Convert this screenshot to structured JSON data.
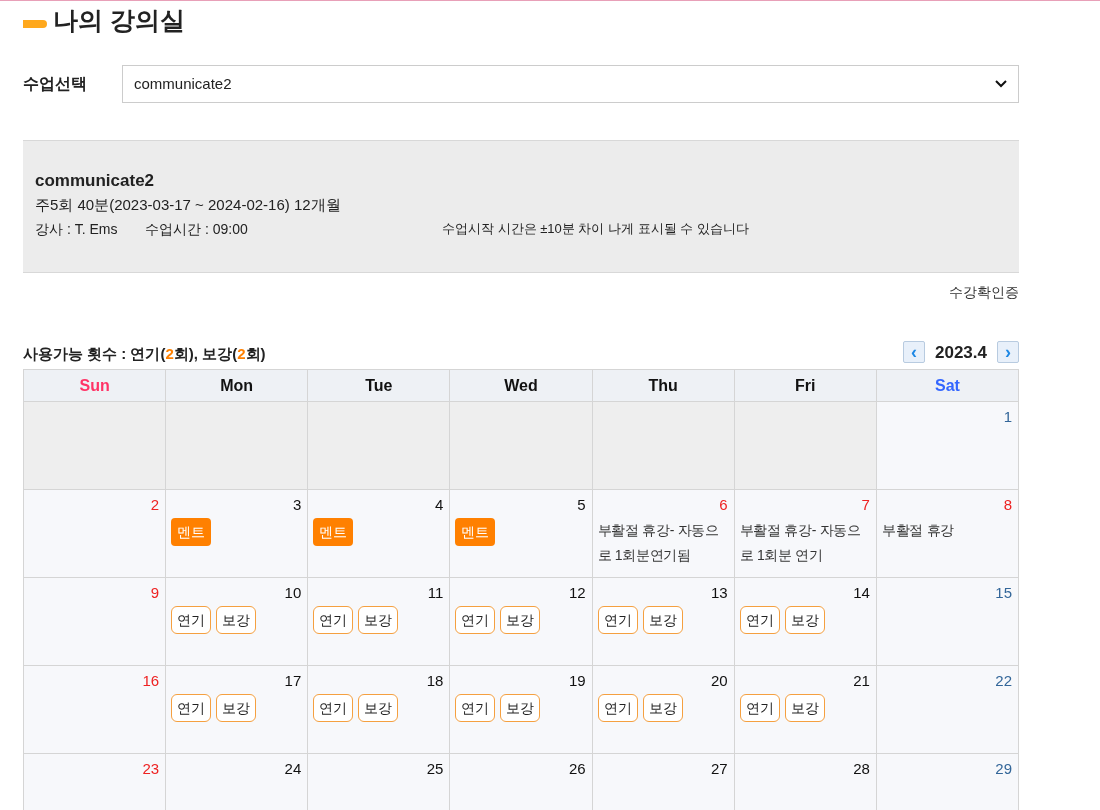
{
  "page_title": "나의 강의실",
  "class_select": {
    "label": "수업선택",
    "value": "communicate2"
  },
  "info": {
    "name": "communicate2",
    "schedule": "주5회 40분(2023-03-17 ~ 2024-02-16) 12개월",
    "teacher": "강사 : T. Ems",
    "time": "수업시간 : 09:00",
    "notice": "수업시작 시간은 ±10분 차이 나게 표시될 수 있습니다"
  },
  "certificate_link": "수강확인증",
  "usage": "사용가능 횟수 : 연기(**2**회), 보강(**2**회)",
  "month": {
    "prev": "‹",
    "label": "2023.4",
    "next": "›"
  },
  "weekdays": [
    {
      "label": "Sun",
      "color": "#ff3366"
    },
    {
      "label": "Mon",
      "color": "#111111"
    },
    {
      "label": "Tue",
      "color": "#111111"
    },
    {
      "label": "Wed",
      "color": "#111111"
    },
    {
      "label": "Thu",
      "color": "#111111"
    },
    {
      "label": "Fri",
      "color": "#111111"
    },
    {
      "label": "Sat",
      "color": "#3366ff"
    }
  ],
  "weeks": [
    [
      {
        "kind": "empty"
      },
      {
        "kind": "empty"
      },
      {
        "kind": "empty"
      },
      {
        "kind": "empty"
      },
      {
        "kind": "empty"
      },
      {
        "kind": "empty"
      },
      {
        "kind": "day",
        "day": "1",
        "color": "#336699"
      }
    ],
    [
      {
        "kind": "day",
        "day": "2",
        "color": "#ee2222"
      },
      {
        "kind": "day",
        "day": "3",
        "color": "#111111",
        "items": [
          {
            "kind": "tag",
            "label": "멘트"
          }
        ]
      },
      {
        "kind": "day",
        "day": "4",
        "color": "#111111",
        "items": [
          {
            "kind": "tag",
            "label": "멘트"
          }
        ]
      },
      {
        "kind": "day",
        "day": "5",
        "color": "#111111",
        "items": [
          {
            "kind": "tag",
            "label": "멘트"
          }
        ]
      },
      {
        "kind": "day",
        "day": "6",
        "color": "#ee2222",
        "items": [
          {
            "kind": "note",
            "label": "부활절 휴강- 자동으로 1회분연기됨"
          }
        ]
      },
      {
        "kind": "day",
        "day": "7",
        "color": "#ee2222",
        "items": [
          {
            "kind": "note",
            "label": "부활절 휴강- 자동으로 1회분 연기"
          }
        ]
      },
      {
        "kind": "day",
        "day": "8",
        "color": "#ee2222",
        "items": [
          {
            "kind": "note",
            "label": "부활절 휴강"
          }
        ]
      }
    ],
    [
      {
        "kind": "day",
        "day": "9",
        "color": "#ee2222"
      },
      {
        "kind": "day",
        "day": "10",
        "color": "#111111",
        "items": [
          {
            "kind": "button",
            "label": "연기"
          },
          {
            "kind": "button",
            "label": "보강"
          }
        ]
      },
      {
        "kind": "day",
        "day": "11",
        "color": "#111111",
        "items": [
          {
            "kind": "button",
            "label": "연기"
          },
          {
            "kind": "button",
            "label": "보강"
          }
        ]
      },
      {
        "kind": "day",
        "day": "12",
        "color": "#111111",
        "items": [
          {
            "kind": "button",
            "label": "연기"
          },
          {
            "kind": "button",
            "label": "보강"
          }
        ]
      },
      {
        "kind": "day",
        "day": "13",
        "color": "#111111",
        "items": [
          {
            "kind": "button",
            "label": "연기"
          },
          {
            "kind": "button",
            "label": "보강"
          }
        ]
      },
      {
        "kind": "day",
        "day": "14",
        "color": "#111111",
        "items": [
          {
            "kind": "button",
            "label": "연기"
          },
          {
            "kind": "button",
            "label": "보강"
          }
        ]
      },
      {
        "kind": "day",
        "day": "15",
        "color": "#336699"
      }
    ],
    [
      {
        "kind": "day",
        "day": "16",
        "color": "#ee2222"
      },
      {
        "kind": "day",
        "day": "17",
        "color": "#111111",
        "items": [
          {
            "kind": "button",
            "label": "연기"
          },
          {
            "kind": "button",
            "label": "보강"
          }
        ]
      },
      {
        "kind": "day",
        "day": "18",
        "color": "#111111",
        "items": [
          {
            "kind": "button",
            "label": "연기"
          },
          {
            "kind": "button",
            "label": "보강"
          }
        ]
      },
      {
        "kind": "day",
        "day": "19",
        "color": "#111111",
        "items": [
          {
            "kind": "button",
            "label": "연기"
          },
          {
            "kind": "button",
            "label": "보강"
          }
        ]
      },
      {
        "kind": "day",
        "day": "20",
        "color": "#111111",
        "items": [
          {
            "kind": "button",
            "label": "연기"
          },
          {
            "kind": "button",
            "label": "보강"
          }
        ]
      },
      {
        "kind": "day",
        "day": "21",
        "color": "#111111",
        "items": [
          {
            "kind": "button",
            "label": "연기"
          },
          {
            "kind": "button",
            "label": "보강"
          }
        ]
      },
      {
        "kind": "day",
        "day": "22",
        "color": "#336699"
      }
    ],
    [
      {
        "kind": "day",
        "day": "23",
        "color": "#ee2222"
      },
      {
        "kind": "day",
        "day": "24",
        "color": "#111111"
      },
      {
        "kind": "day",
        "day": "25",
        "color": "#111111"
      },
      {
        "kind": "day",
        "day": "26",
        "color": "#111111"
      },
      {
        "kind": "day",
        "day": "27",
        "color": "#111111"
      },
      {
        "kind": "day",
        "day": "28",
        "color": "#111111"
      },
      {
        "kind": "day",
        "day": "29",
        "color": "#336699"
      }
    ]
  ]
}
